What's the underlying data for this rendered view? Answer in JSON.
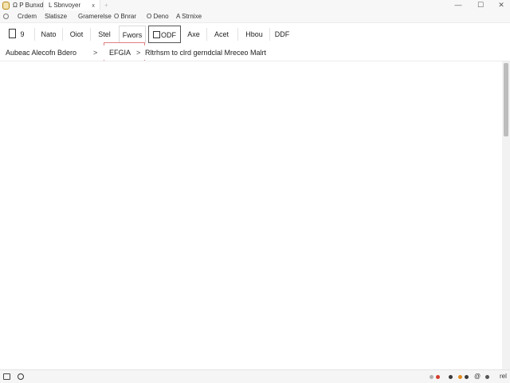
{
  "titlebar": {
    "tabs": [
      {
        "label": "Ω P  Bunxd",
        "close": ""
      },
      {
        "label": "L Sbnvoyer",
        "close": "x"
      }
    ],
    "new_tab": "+",
    "minimize": "—",
    "maximize": "☐",
    "close": "✕"
  },
  "menubar": {
    "items": [
      "Crdem",
      "Slatisze",
      "Gramerelse",
      "O Bnrar",
      "O Deno",
      "A Strnixe"
    ]
  },
  "toolbar": {
    "first_count": "9",
    "buttons": [
      "Nato",
      "Oiot",
      "Stel",
      "Fwors",
      "ODF",
      "Axe",
      "Acet",
      "Hbou",
      "DDF"
    ]
  },
  "breadcrumb": {
    "items": [
      "Aubeac Alecofn  Bdero",
      "EFGIA",
      "Rltrhsm to clrd gerndclal Mreceo Malrt"
    ],
    "separator": ">"
  },
  "statusbar": {
    "tray_symbol": "@",
    "tray_text": "rel"
  },
  "colors": {
    "accent_border": "#e08080",
    "app_icon": "#b8860b",
    "tray_red": "#d33c2c",
    "tray_orange": "#e08a1e"
  }
}
